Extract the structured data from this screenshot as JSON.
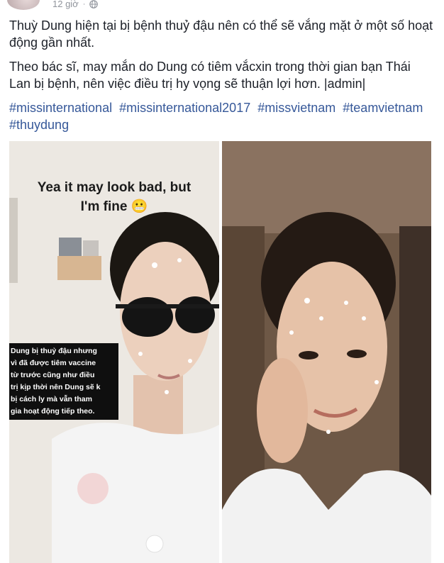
{
  "post": {
    "time": "12 giờ",
    "separator": "·",
    "paragraphs": [
      "Thuỳ Dung hiện tại bị bệnh thuỷ đậu nên có thể sẽ vắng mặt ở một số hoạt động gần nhất.",
      "Theo bác sĩ, may mắn do Dung có tiêm vắcxin trong thời gian bạn Thái Lan bị bệnh, nên việc điều trị hy vọng sẽ thuận lợi hơn. |admin|"
    ],
    "hashtags": [
      "#missinternational",
      "#missinternational2017",
      "#missvietnam",
      "#teamvietnam",
      "#thuydung"
    ]
  },
  "photos": {
    "left": {
      "caption_line1": "Yea it may look bad, but",
      "caption_line2": "I'm fine 😬",
      "side_text": [
        "Dung bị thuỷ đậu nhưng",
        "vì đã được tiêm vaccine",
        "từ trước cũng như điều",
        "trị kịp thời nên Dung sẽ k",
        "bị cách ly mà vẫn tham",
        "gia hoạt động tiếp theo."
      ]
    }
  },
  "colors": {
    "link": "#365899",
    "meta": "#90949c",
    "text": "#1d2129"
  }
}
